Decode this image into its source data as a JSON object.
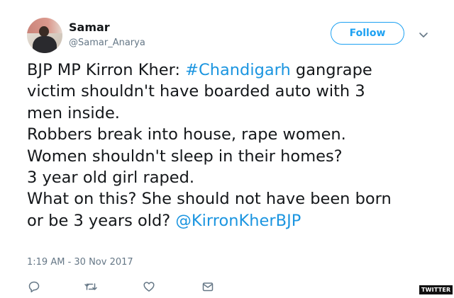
{
  "user": {
    "name": "Samar",
    "handle": "@Samar_Anarya"
  },
  "follow_button": {
    "label": "Follow"
  },
  "tweet": {
    "line1": {
      "pre": "BJP MP Kirron Kher: ",
      "hashtag": "#Chandigarh",
      "post": " gangrape"
    },
    "line2": "victim shouldn't have boarded auto with 3",
    "line3": "men inside.",
    "line4": "Robbers break into house, rape women.",
    "line5": "Women shouldn't sleep in their homes?",
    "line6": "3 year old girl raped.",
    "line7": "What on this? She should not have been born",
    "line8": {
      "pre": "or be 3 years old? ",
      "mention": "@KirronKherBJP"
    }
  },
  "timestamp": "1:19 AM - 30 Nov 2017",
  "actions": {
    "reply_icon": "reply-icon",
    "retweet_icon": "retweet-icon",
    "like_icon": "heart-icon",
    "dm_icon": "envelope-icon",
    "caret_icon": "chevron-down-icon"
  },
  "watermark": "TWITTER",
  "colors": {
    "link": "#1b95e0",
    "follow": "#1da1f2",
    "secondary_text": "#657786",
    "icon": "#657786"
  }
}
